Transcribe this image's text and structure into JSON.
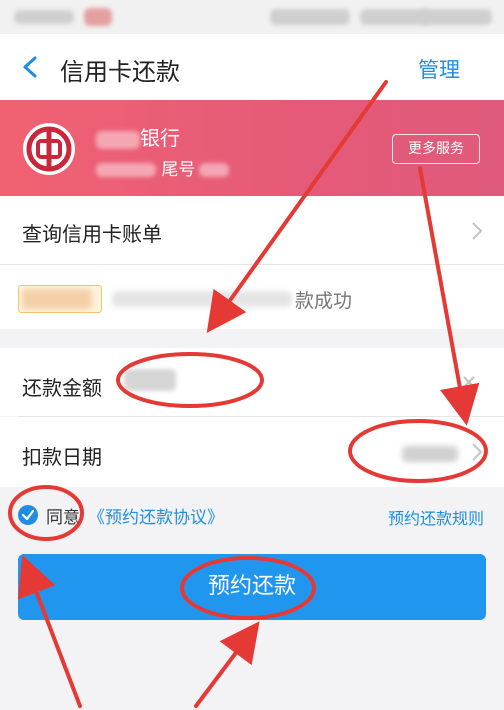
{
  "nav": {
    "title": "信用卡还款",
    "manage_label": "管理"
  },
  "bank": {
    "name_suffix": "银行",
    "tail_label": "尾号",
    "more_services": "更多服务"
  },
  "rows": {
    "query_bill": "查询信用卡账单",
    "notice_suffix": "款成功",
    "amount_label": "还款金额",
    "date_label": "扣款日期"
  },
  "agree": {
    "label": "同意",
    "agreement_link": "《预约还款协议》",
    "rules_link": "预约还款规则"
  },
  "submit_label": "预约还款",
  "colors": {
    "accent": "#1f8ee0",
    "banner": "#e85c76",
    "annotation": "#e53935"
  }
}
